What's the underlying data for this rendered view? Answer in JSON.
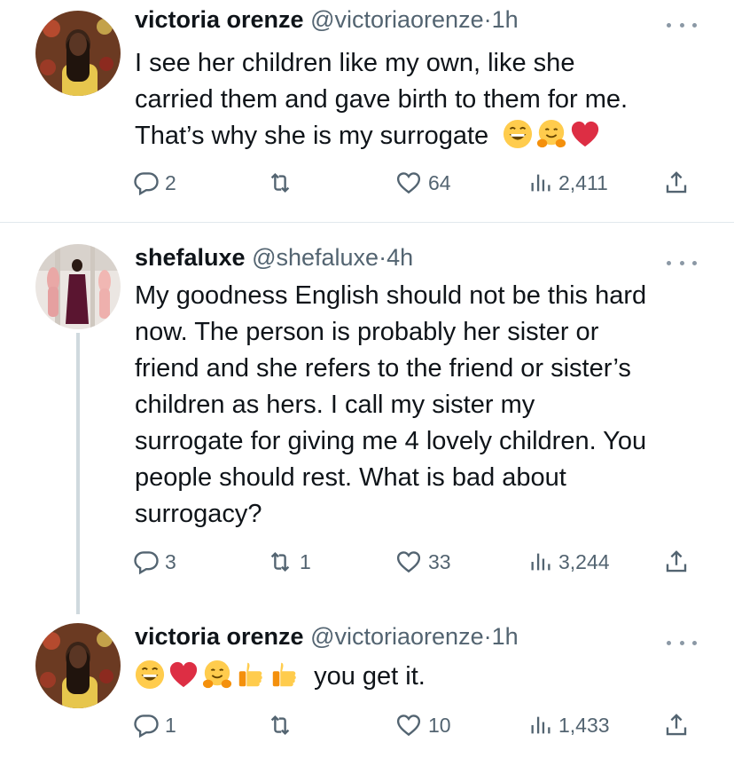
{
  "tweets": [
    {
      "name": "victoria orenze",
      "handle": "@victoriaorenze",
      "dot": "·",
      "time": "1h",
      "text_lines": [
        "I see her children like my own, like she",
        "carried them and gave birth to them for me.",
        "That’s why she is my surrogate"
      ],
      "emojis": [
        "grinning-face",
        "hugging-face",
        "red-heart"
      ],
      "replies": "2",
      "retweets": "",
      "likes": "64",
      "views": "2,411"
    },
    {
      "name": "shefaluxe",
      "handle": "@shefaluxe",
      "dot": "·",
      "time": "4h",
      "text_lines": [
        "My goodness English should not be this hard",
        "now. The person is probably her sister or",
        "friend and she refers to the friend or sister’s",
        "children as hers. I call my sister my",
        "surrogate for giving me 4 lovely children. You",
        "people should rest. What is bad about",
        "surrogacy?"
      ],
      "replies": "3",
      "retweets": "1",
      "likes": "33",
      "views": "3,244"
    },
    {
      "name": "victoria orenze",
      "handle": "@victoriaorenze",
      "dot": "·",
      "time": "1h",
      "text_after_emojis": "you get it.",
      "emojis": [
        "grinning-face",
        "red-heart",
        "hugging-face",
        "thumbs-up",
        "thumbs-up"
      ],
      "replies": "1",
      "retweets": "",
      "likes": "10",
      "views": "1,433"
    }
  ],
  "colors": {
    "text": "#0f1419",
    "secondary": "#536471",
    "divider": "#e1e8ed",
    "thread_line": "#cfd9de"
  }
}
